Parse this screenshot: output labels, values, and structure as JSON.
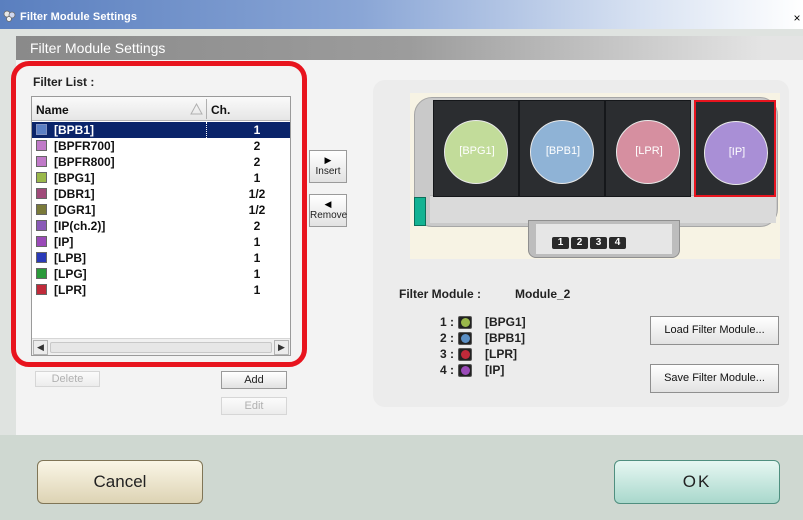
{
  "window": {
    "title": "Filter Module Settings",
    "close_glyph": "×"
  },
  "header": {
    "title": "Filter Module Settings"
  },
  "filter_list": {
    "label": "Filter List :",
    "columns": {
      "name": "Name",
      "ch": "Ch."
    },
    "rows": [
      {
        "name": "[BPB1]",
        "ch": "1",
        "color": "#5b7fc4",
        "selected": true
      },
      {
        "name": "[BPFR700]",
        "ch": "2",
        "color": "#c07ac8"
      },
      {
        "name": "[BPFR800]",
        "ch": "2",
        "color": "#c07ac8"
      },
      {
        "name": "[BPG1]",
        "ch": "1",
        "color": "#9ab84a"
      },
      {
        "name": "[DBR1]",
        "ch": "1/2",
        "color": "#a04a7a"
      },
      {
        "name": "[DGR1]",
        "ch": "1/2",
        "color": "#7a7a3a"
      },
      {
        "name": "[IP(ch.2)]",
        "ch": "2",
        "color": "#8a5ab8"
      },
      {
        "name": "[IP]",
        "ch": "1",
        "color": "#9a4ab8"
      },
      {
        "name": "[LPB]",
        "ch": "1",
        "color": "#2a3ab8"
      },
      {
        "name": "[LPG]",
        "ch": "1",
        "color": "#2a9a3a"
      },
      {
        "name": "[LPR]",
        "ch": "1",
        "color": "#c02a3a"
      }
    ]
  },
  "actions": {
    "insert": "Insert",
    "remove": "Remove",
    "delete": "Delete",
    "add": "Add",
    "edit": "Edit"
  },
  "module": {
    "label": "Filter Module :",
    "name": "Module_2",
    "slots": [
      {
        "label": "[BPG1]",
        "color": "#c2dc9a",
        "selected": false
      },
      {
        "label": "[BPB1]",
        "color": "#8fb3d6",
        "selected": false
      },
      {
        "label": "[LPR]",
        "color": "#d68fa0",
        "selected": false
      },
      {
        "label": "[IP]",
        "color": "#a98fd6",
        "selected": true
      }
    ],
    "tab_numbers": [
      "1",
      "2",
      "3",
      "4"
    ],
    "entries": [
      {
        "num": "1 :",
        "name": "[BPG1]",
        "color": "#9ab84a"
      },
      {
        "num": "2 :",
        "name": "[BPB1]",
        "color": "#5b8fc4"
      },
      {
        "num": "3 :",
        "name": "[LPR]",
        "color": "#c02a3a"
      },
      {
        "num": "4 :",
        "name": "[IP]",
        "color": "#9a4ab8"
      }
    ],
    "load_label": "Load Filter Module...",
    "save_label": "Save Filter Module..."
  },
  "footer": {
    "cancel_label": "Cancel",
    "ok_label": "OK"
  }
}
